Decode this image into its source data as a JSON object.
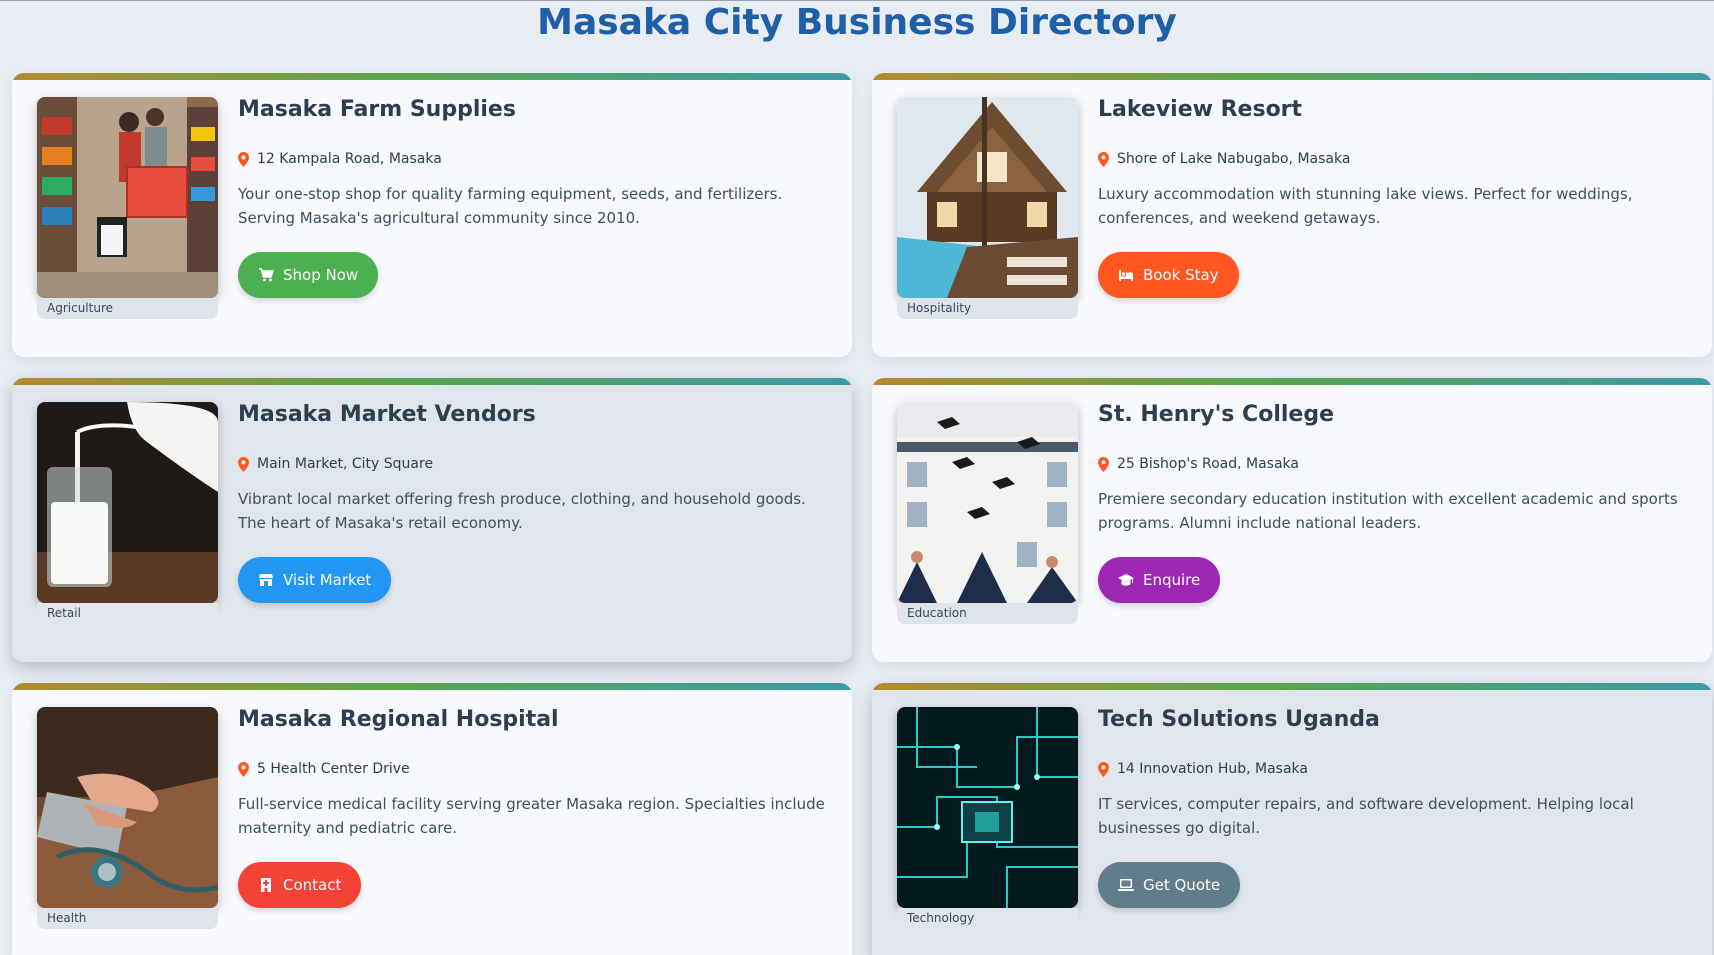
{
  "page": {
    "title": "Masaka City Business Directory"
  },
  "businesses": [
    {
      "name": "Masaka Farm Supplies",
      "category": "Agriculture",
      "address": "12 Kampala Road, Masaka",
      "description": "Your one-stop shop for quality farming equipment, seeds, and fertilizers. Serving Masaka's agricultural community since 2010.",
      "button_label": "Shop Now",
      "button_icon": "cart-icon",
      "button_color": "#4caf50"
    },
    {
      "name": "Lakeview Resort",
      "category": "Hospitality",
      "address": "Shore of Lake Nabugabo, Masaka",
      "description": "Luxury accommodation with stunning lake views. Perfect for weddings, conferences, and weekend getaways.",
      "button_label": "Book Stay",
      "button_icon": "bed-icon",
      "button_color": "#ff5722"
    },
    {
      "name": "Masaka Market Vendors",
      "category": "Retail",
      "address": "Main Market, City Square",
      "description": "Vibrant local market offering fresh produce, clothing, and household goods. The heart of Masaka's retail economy.",
      "button_label": "Visit Market",
      "button_icon": "store-icon",
      "button_color": "#2196f3"
    },
    {
      "name": "St. Henry's College",
      "category": "Education",
      "address": "25 Bishop's Road, Masaka",
      "description": "Premiere secondary education institution with excellent academic and sports programs. Alumni include national leaders.",
      "button_label": "Enquire",
      "button_icon": "graduation-cap-icon",
      "button_color": "#9c27b0"
    },
    {
      "name": "Masaka Regional Hospital",
      "category": "Health",
      "address": "5 Health Center Drive",
      "description": "Full-service medical facility serving greater Masaka region. Specialties include maternity and pediatric care.",
      "button_label": "Contact",
      "button_icon": "hospital-icon",
      "button_color": "#f44336"
    },
    {
      "name": "Tech Solutions Uganda",
      "category": "Technology",
      "address": "14 Innovation Hub, Masaka",
      "description": "IT services, computer repairs, and software development. Helping local businesses go digital.",
      "button_label": "Get Quote",
      "button_icon": "laptop-icon",
      "button_color": "#607d8b"
    }
  ],
  "colors": {
    "title": "#1e5fa8",
    "pin": "#ff5722"
  }
}
